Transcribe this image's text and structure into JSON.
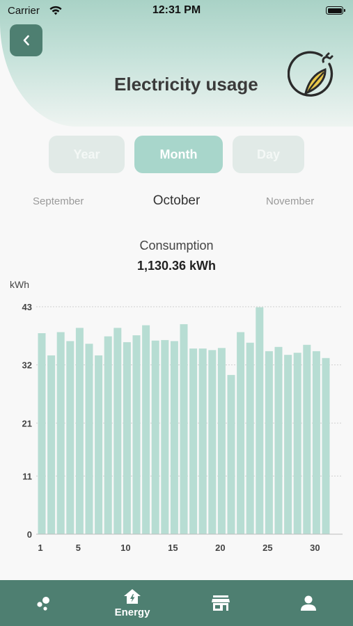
{
  "status_bar": {
    "carrier": "Carrier",
    "time": "12:31 PM"
  },
  "header": {
    "title": "Electricity usage",
    "back_icon": "chevron-left-icon",
    "logo_icon": "leaf-plug-icon"
  },
  "period_tabs": {
    "year": "Year",
    "month": "Month",
    "day": "Day",
    "selected": "Month"
  },
  "month_selector": {
    "previous": "September",
    "current": "October",
    "next": "November"
  },
  "summary": {
    "label": "Consumption",
    "value": "1,130.36 kWh"
  },
  "colors": {
    "accent": "#4e7f71",
    "bar": "#b7ddd3",
    "tab_active": "#a8d6cb"
  },
  "chart_data": {
    "type": "bar",
    "ylabel": "kWh",
    "ylim": [
      0,
      43
    ],
    "y_ticks": [
      "0",
      "11",
      "21",
      "32",
      "43"
    ],
    "y_tick_values": [
      0,
      11,
      21,
      32,
      43
    ],
    "x_ticks": [
      "1",
      "5",
      "10",
      "15",
      "20",
      "25",
      "30"
    ],
    "x_tick_values": [
      1,
      5,
      10,
      15,
      20,
      25,
      30
    ],
    "x": [
      1,
      2,
      3,
      4,
      5,
      6,
      7,
      8,
      9,
      10,
      11,
      12,
      13,
      14,
      15,
      16,
      17,
      18,
      19,
      20,
      21,
      22,
      23,
      24,
      25,
      26,
      27,
      28,
      29,
      30,
      31
    ],
    "values": [
      38,
      33.8,
      38.2,
      36.5,
      39,
      36,
      33.8,
      37.4,
      39,
      36.3,
      37.6,
      39.5,
      36.6,
      36.7,
      36.5,
      39.7,
      35.1,
      35.1,
      34.8,
      35.2,
      30.1,
      38.2,
      36.2,
      42.9,
      34.6,
      35.4,
      33.9,
      34.3,
      35.8,
      34.6,
      33.3
    ]
  },
  "bottom_nav": [
    {
      "icon": "bubbles-icon",
      "label": ""
    },
    {
      "icon": "home-energy-icon",
      "label": "Energy"
    },
    {
      "icon": "store-icon",
      "label": ""
    },
    {
      "icon": "person-icon",
      "label": ""
    }
  ]
}
